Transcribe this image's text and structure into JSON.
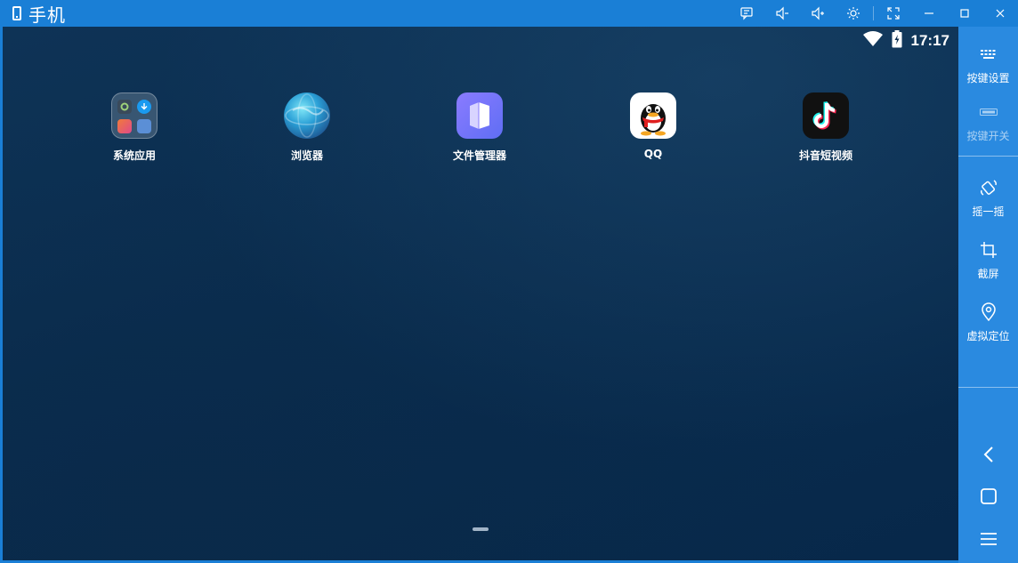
{
  "window": {
    "title": "手机"
  },
  "titlebar": {
    "buttons": [
      {
        "name": "message-icon"
      },
      {
        "name": "volume-down-icon"
      },
      {
        "name": "volume-up-icon"
      },
      {
        "name": "settings-icon"
      },
      {
        "name": "fullscreen-icon"
      },
      {
        "name": "minimize-icon"
      },
      {
        "name": "maximize-icon"
      },
      {
        "name": "close-icon"
      }
    ]
  },
  "statusbar": {
    "time": "17:17",
    "icons": [
      "wifi-icon",
      "battery-charging-icon"
    ]
  },
  "apps": [
    {
      "label": "系统应用",
      "icon": "folder-icon"
    },
    {
      "label": "浏览器",
      "icon": "browser-icon"
    },
    {
      "label": "文件管理器",
      "icon": "file-manager-icon"
    },
    {
      "label": "QQ",
      "icon": "qq-icon"
    },
    {
      "label": "抖音短视频",
      "icon": "tiktok-icon"
    }
  ],
  "sidebar": {
    "items": [
      {
        "label": "按键设置",
        "icon": "keyboard-icon",
        "enabled": true
      },
      {
        "label": "按键开关",
        "icon": "toggle-icon",
        "enabled": false
      },
      {
        "label": "摇一摇",
        "icon": "shake-icon",
        "enabled": true
      },
      {
        "label": "截屏",
        "icon": "crop-icon",
        "enabled": true
      },
      {
        "label": "虚拟定位",
        "icon": "location-pin-icon",
        "enabled": true
      }
    ],
    "nav": [
      "back-icon",
      "home-icon",
      "menu-icon"
    ]
  },
  "colors": {
    "titlebar": "#1a7fd6",
    "sidebar": "#2a8ae0",
    "screen": "#0a2d4f"
  }
}
